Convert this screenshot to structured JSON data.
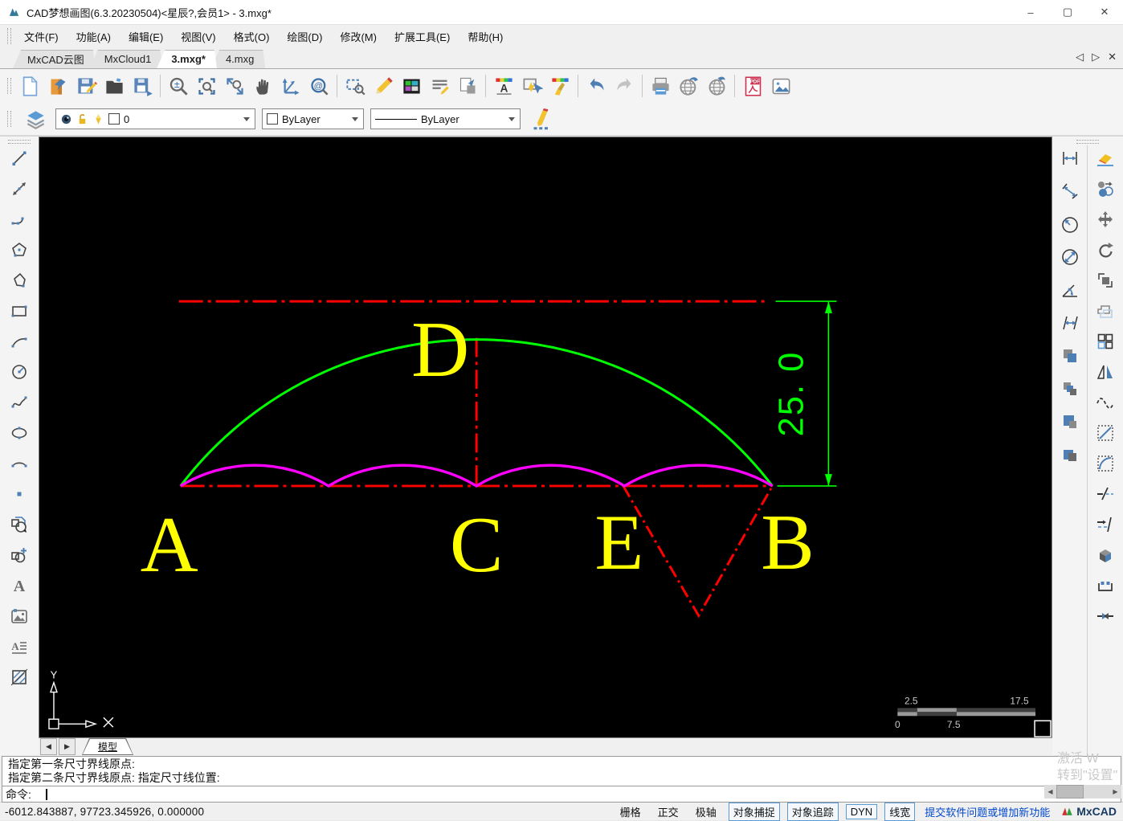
{
  "window": {
    "title": "CAD梦想画图(6.3.20230504)<星辰?,会员1> - 3.mxg*",
    "minimize": "–",
    "maximize": "▢",
    "close": "✕"
  },
  "menu": {
    "items": [
      {
        "label": "文件(F)"
      },
      {
        "label": "功能(A)"
      },
      {
        "label": "编辑(E)"
      },
      {
        "label": "视图(V)"
      },
      {
        "label": "格式(O)"
      },
      {
        "label": "绘图(D)"
      },
      {
        "label": "修改(M)"
      },
      {
        "label": "扩展工具(E)"
      },
      {
        "label": "帮助(H)"
      }
    ]
  },
  "tabs": {
    "items": [
      {
        "label": "MxCAD云图"
      },
      {
        "label": "MxCloud1"
      },
      {
        "label": "3.mxg*"
      },
      {
        "label": "4.mxg"
      }
    ],
    "prev": "◁",
    "next": "▷",
    "close": "✕"
  },
  "properties_bar": {
    "layer": {
      "value": "0"
    },
    "color": {
      "value": "ByLayer"
    },
    "linetype": {
      "value": "ByLayer"
    }
  },
  "toolbars": {
    "standard": [
      "new-file",
      "open-cloud",
      "save",
      "open-folder",
      "save-as",
      "zoom-adjust",
      "zoom-window",
      "zoom-extents",
      "pan-hand",
      "ucs-axes",
      "zoom-center",
      "select-zoom",
      "draw-pencil",
      "color-palette",
      "text-lines",
      "page-copy",
      "text-style",
      "quick-select",
      "match-properties",
      "undo",
      "redo",
      "print",
      "publish-web",
      "open-web",
      "export-pdf",
      "insert-image"
    ],
    "draw_left": [
      "line",
      "construction-line",
      "polyline",
      "polygon",
      "irregular-polygon",
      "rectangle",
      "arc",
      "circle",
      "spline",
      "ellipse",
      "ellipse-arc",
      "point",
      "insert-block",
      "create-block",
      "text",
      "image",
      "mtext",
      "hatch"
    ],
    "dimension_right": [
      "dim-linear",
      "dim-aligned",
      "dim-radius",
      "dim-diameter",
      "dim-angular",
      "dim-baseline",
      "copy-clip",
      "copy-base",
      "paste-clip",
      "paste-block"
    ],
    "modify_right": [
      "erase",
      "copy-object",
      "move",
      "rotate",
      "scale",
      "offset",
      "array",
      "mirror",
      "revision-cloud",
      "lengthen",
      "fillet",
      "trim",
      "extend",
      "explode",
      "break",
      "join"
    ]
  },
  "drawing": {
    "labels": {
      "a": "A",
      "b": "B",
      "c": "C",
      "d": "D",
      "e": "E"
    },
    "dimension_text": "25. 0",
    "ucs": {
      "x_label": "X",
      "y_label": "Y"
    },
    "scalebar": {
      "top_left": "2.5",
      "top_right": "17.5",
      "bottom_left": "0",
      "bottom_mid": "7.5"
    },
    "colors": {
      "arc": "#00ff00",
      "scallops": "#ff00ff",
      "centerlines": "#ff0000",
      "labels": "#ffff00",
      "dimension": "#00ff00",
      "background": "#000000"
    }
  },
  "model_bar": {
    "prev": "◀",
    "next": "▶",
    "tab": "模型"
  },
  "command": {
    "history_line1": "指定第一条尺寸界线原点:",
    "history_line2": "指定第二条尺寸界线原点:  指定尺寸线位置:",
    "prompt": "命令:"
  },
  "watermark": {
    "line1": "激活 W",
    "line2": "转到\"设置\""
  },
  "statusbar": {
    "coordinates": "-6012.843887,  97723.345926,  0.000000",
    "toggles": [
      {
        "label": "栅格",
        "active": false
      },
      {
        "label": "正交",
        "active": false
      },
      {
        "label": "极轴",
        "active": false
      },
      {
        "label": "对象捕捉",
        "active": true
      },
      {
        "label": "对象追踪",
        "active": true
      },
      {
        "label": "DYN",
        "active": true
      },
      {
        "label": "线宽",
        "active": true
      }
    ],
    "link": "提交软件问题或增加新功能",
    "brand": "MxCAD"
  }
}
